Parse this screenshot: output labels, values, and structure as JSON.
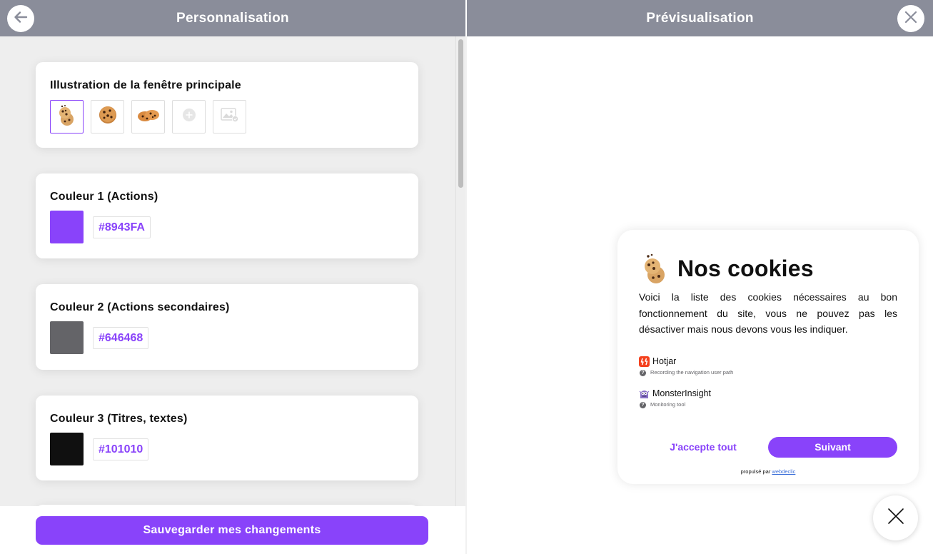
{
  "header": {
    "left_title": "Personnalisation",
    "right_title": "Prévisualisation"
  },
  "illustration_card": {
    "title": "Illustration de la fenêtre principale",
    "options": [
      {
        "icon": "cookie-stack-icon",
        "selected": true
      },
      {
        "icon": "cookie-icon",
        "selected": false
      },
      {
        "icon": "cookies-pair-icon",
        "selected": false
      },
      {
        "icon": "add-icon",
        "selected": false
      },
      {
        "icon": "image-upload-icon",
        "selected": false
      }
    ]
  },
  "colors": [
    {
      "label": "Couleur 1 (Actions)",
      "hex": "#8943FA"
    },
    {
      "label": "Couleur 2 (Actions secondaires)",
      "hex": "#646468"
    },
    {
      "label": "Couleur 3 (Titres, textes)",
      "hex": "#101010"
    }
  ],
  "save_label": "Sauvegarder mes changements",
  "preview": {
    "title": "Nos cookies",
    "description": "Voici la liste des cookies nécessaires au bon fonctionnement du site, vous ne pouvez pas les désactiver mais nous devons vous les indiquer.",
    "services": [
      {
        "name": "Hotjar",
        "description": "Recording the navigation user path",
        "icon": "hotjar-icon"
      },
      {
        "name": "MonsterInsight",
        "description": "Monitoring tool",
        "icon": "monsterinsight-icon"
      }
    ],
    "accept_label": "J'accepte tout",
    "next_label": "Suivant",
    "powered_prefix": "propulsé par",
    "powered_brand": "webdeclic"
  },
  "theme": {
    "accent": "#8943FA",
    "secondary": "#646468",
    "text": "#101010",
    "header_bg": "#8a8d9a"
  }
}
